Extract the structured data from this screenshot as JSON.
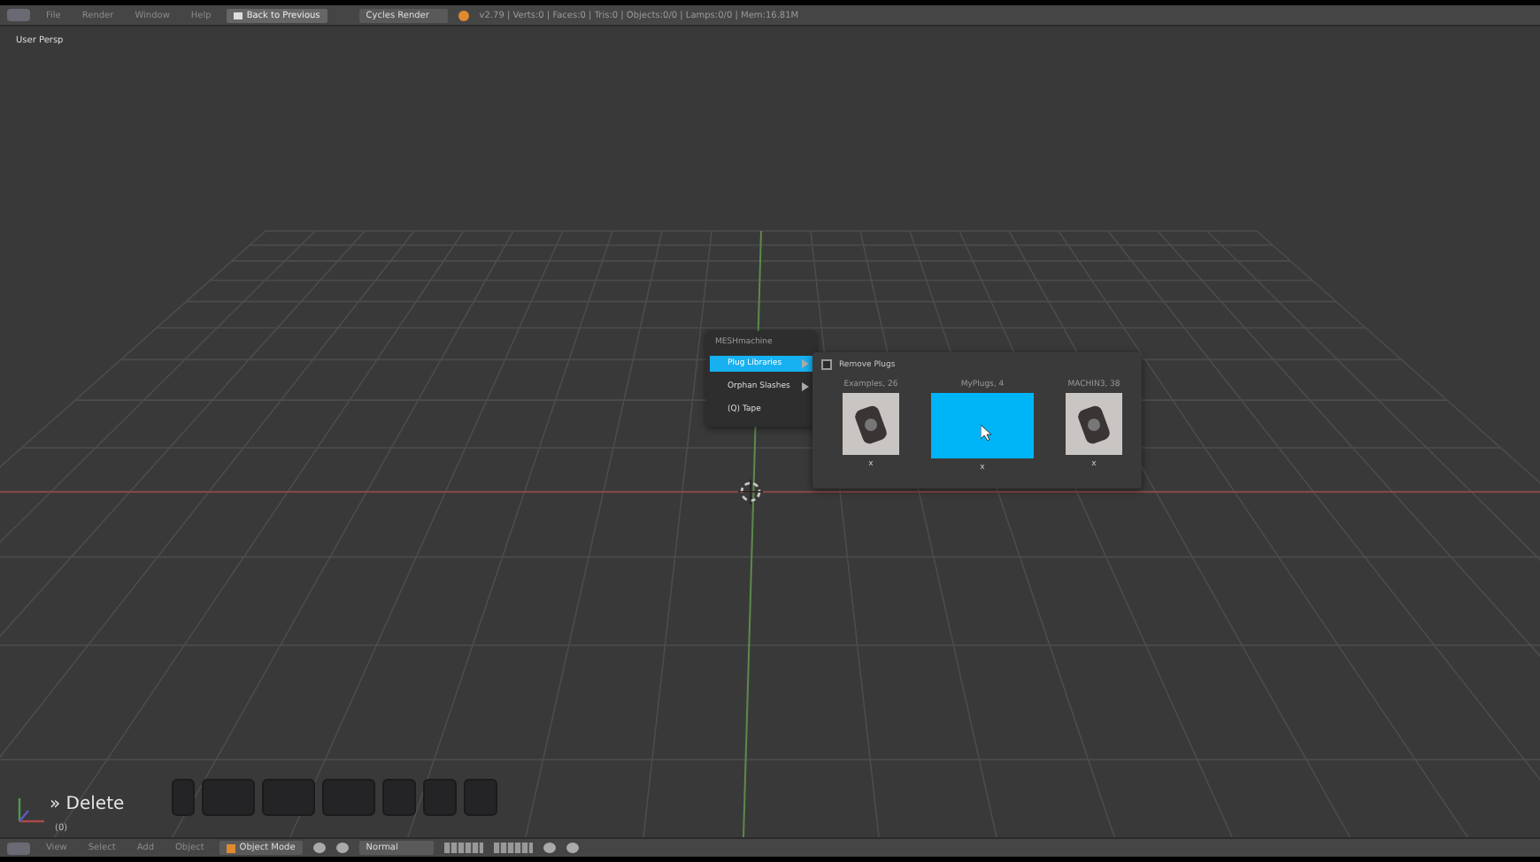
{
  "header": {
    "menu": [
      "File",
      "Render",
      "Window",
      "Help"
    ],
    "back_button": "Back to Previous",
    "render_engine": "Cycles Render",
    "stats": "v2.79 | Verts:0 | Faces:0 | Tris:0 | Objects:0/0 | Lamps:0/0 | Mem:16.81M"
  },
  "viewport": {
    "view_label": "User Persp",
    "operator": "» Delete",
    "frame": "(0)"
  },
  "menu": {
    "title": "MESHmachine",
    "items": [
      {
        "label": "Plug Libraries",
        "selected": true,
        "submenu": true
      },
      {
        "label": "Orphan Slashes",
        "selected": false,
        "submenu": true
      },
      {
        "label": "(Q) Tape",
        "selected": false,
        "submenu": false
      }
    ]
  },
  "submenu": {
    "remove_plugs": {
      "label": "Remove Plugs",
      "checked": false
    },
    "libraries": [
      {
        "name": "Examples, 26",
        "selected": false,
        "remove": "x"
      },
      {
        "name": "MyPlugs, 4",
        "selected": true,
        "remove": "x"
      },
      {
        "name": "MACHIN3, 38",
        "selected": false,
        "remove": "x"
      }
    ]
  },
  "footer": {
    "menu": [
      "View",
      "Select",
      "Add",
      "Object"
    ],
    "mode": "Object Mode",
    "pivot": "Normal"
  }
}
